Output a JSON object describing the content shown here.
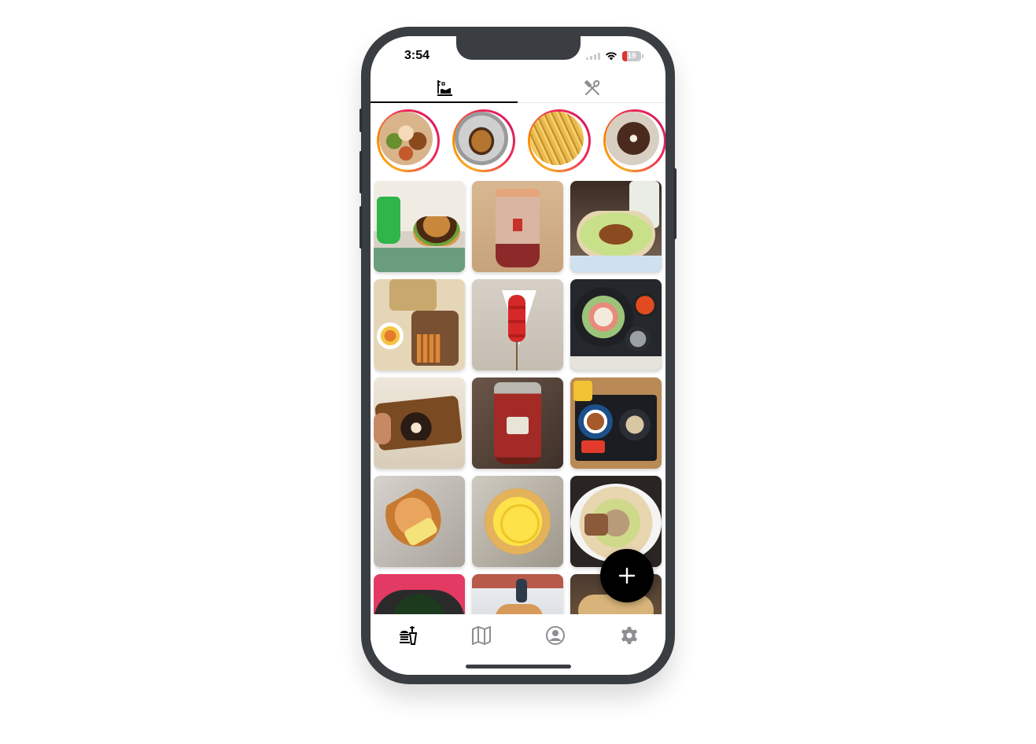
{
  "status_bar": {
    "time": "3:54",
    "battery": "19"
  },
  "top_tabs": [
    {
      "icon": "food-history-icon",
      "active": true
    },
    {
      "icon": "fork-knife-crossed-icon",
      "active": false
    }
  ],
  "stories": [
    {
      "name": "burger-platter-story"
    },
    {
      "name": "burger-story"
    },
    {
      "name": "fries-story"
    },
    {
      "name": "donut-story"
    }
  ],
  "photos": [
    {
      "name": "burger-and-melon-soda"
    },
    {
      "name": "bubble-tea"
    },
    {
      "name": "hot-dog-and-coffee"
    },
    {
      "name": "churros-tray"
    },
    {
      "name": "strawberry-skewer"
    },
    {
      "name": "sashimi-set"
    },
    {
      "name": "shiba-burger-box"
    },
    {
      "name": "milk-tea-cup"
    },
    {
      "name": "japanese-set-meal"
    },
    {
      "name": "bread-roll"
    },
    {
      "name": "custard-bun"
    },
    {
      "name": "ramen-bowl"
    },
    {
      "name": "seaweed-ramen"
    },
    {
      "name": "cafe-drink"
    },
    {
      "name": "pastry-plate"
    }
  ],
  "fab": {
    "label": "+"
  },
  "bottom_nav": [
    {
      "icon": "food-icon",
      "active": true
    },
    {
      "icon": "map-icon",
      "active": false
    },
    {
      "icon": "profile-icon",
      "active": false
    },
    {
      "icon": "settings-icon",
      "active": false
    }
  ],
  "colors": {
    "accent": "#000000",
    "inactive": "#8e8e93",
    "story_ring": "#ef2d56"
  }
}
